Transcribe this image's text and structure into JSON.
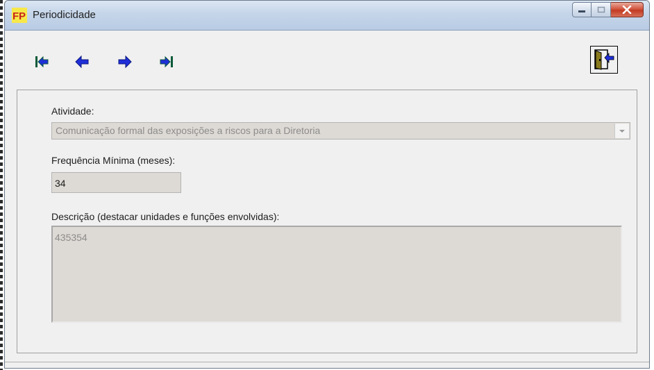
{
  "window": {
    "title": "Periodicidade",
    "app_icon": "fp-app-icon",
    "buttons": [
      "minimize-icon",
      "maximize-icon",
      "close-icon"
    ],
    "colors": {
      "titlebar": "#c5d5e9",
      "close": "#c23b22"
    }
  },
  "toolbar": {
    "nav": [
      "first-record-icon",
      "previous-record-icon",
      "next-record-icon",
      "last-record-icon"
    ],
    "exit": "exit-door-icon",
    "nav_colors": {
      "edge": "#0a5a3a",
      "arrow": "#1f2fd8"
    }
  },
  "form": {
    "activity_label": "Atividade:",
    "activity_value": "Comunicação formal das exposições a riscos para a Diretoria",
    "frequency_label": "Frequência Mínima (meses):",
    "frequency_value": "34",
    "description_label": "Descrição (destacar unidades e funções envolvidas):",
    "description_value": "435354"
  }
}
